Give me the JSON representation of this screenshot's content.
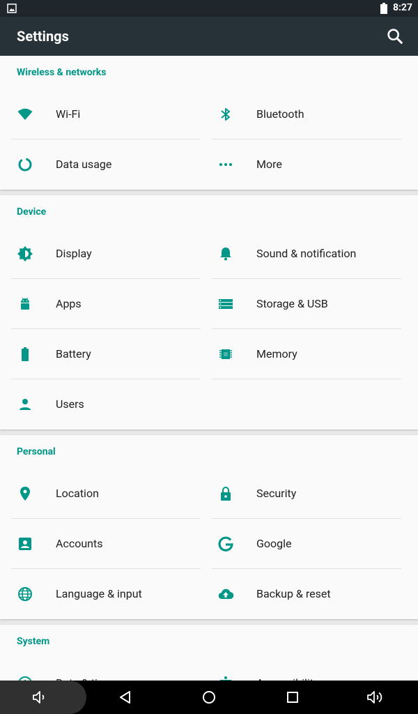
{
  "status_bar": {
    "time": "8:27"
  },
  "app_bar": {
    "title": "Settings"
  },
  "sections": [
    {
      "header": "Wireless & networks",
      "items": [
        {
          "label": "Wi-Fi",
          "icon": "wifi-icon"
        },
        {
          "label": "Bluetooth",
          "icon": "bluetooth-icon"
        },
        {
          "label": "Data usage",
          "icon": "data-usage-icon"
        },
        {
          "label": "More",
          "icon": "more-icon"
        }
      ]
    },
    {
      "header": "Device",
      "items": [
        {
          "label": "Display",
          "icon": "brightness-icon"
        },
        {
          "label": "Sound & notification",
          "icon": "bell-icon"
        },
        {
          "label": "Apps",
          "icon": "android-icon"
        },
        {
          "label": "Storage & USB",
          "icon": "storage-icon"
        },
        {
          "label": "Battery",
          "icon": "battery-icon"
        },
        {
          "label": "Memory",
          "icon": "memory-chip-icon"
        },
        {
          "label": "Users",
          "icon": "person-icon"
        }
      ]
    },
    {
      "header": "Personal",
      "items": [
        {
          "label": "Location",
          "icon": "location-pin-icon"
        },
        {
          "label": "Security",
          "icon": "lock-icon"
        },
        {
          "label": "Accounts",
          "icon": "account-box-icon"
        },
        {
          "label": "Google",
          "icon": "google-g-icon"
        },
        {
          "label": "Language & input",
          "icon": "globe-icon"
        },
        {
          "label": "Backup & reset",
          "icon": "cloud-upload-icon"
        }
      ]
    },
    {
      "header": "System",
      "items": [
        {
          "label": "Date & time",
          "icon": "clock-icon"
        },
        {
          "label": "Accessibility",
          "icon": "accessibility-icon"
        }
      ]
    }
  ],
  "nav_bar": {
    "buttons": [
      "volume-down-icon",
      "back-icon",
      "home-icon",
      "recents-icon",
      "volume-up-icon"
    ]
  },
  "colors": {
    "accent": "#009688",
    "toolbar": "#263238",
    "status_bar": "#1f272c"
  }
}
